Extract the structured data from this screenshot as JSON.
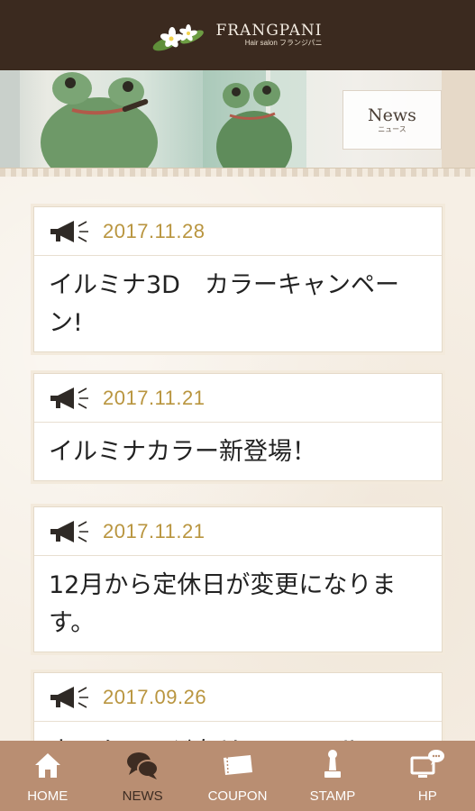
{
  "header": {
    "brand_name": "FRANGPANI",
    "brand_sub": "Hair salon フランジパニ",
    "logo_icon": "plumeria-flower-icon"
  },
  "banner": {
    "label_en": "News",
    "label_ja": "ニュース"
  },
  "news": [
    {
      "date": "2017.11.28",
      "title": "イルミナ3D　カラーキャンペーン!"
    },
    {
      "date": "2017.11.21",
      "title": "イルミナカラー新登場！"
    },
    {
      "date": "2017.11.21",
      "title": "12月から定休日が変更になります。"
    },
    {
      "date": "2017.09.26",
      "title": "ホームページをリニューアル"
    }
  ],
  "tabs": [
    {
      "label": "HOME",
      "icon": "home-icon",
      "active": false
    },
    {
      "label": "NEWS",
      "icon": "chat-bubbles-icon",
      "active": true
    },
    {
      "label": "COUPON",
      "icon": "coupon-ticket-icon",
      "active": false
    },
    {
      "label": "STAMP",
      "icon": "stamp-icon",
      "active": false
    },
    {
      "label": "HP",
      "icon": "monitor-chat-icon",
      "active": false
    }
  ],
  "colors": {
    "header_bg": "#3b2a1f",
    "date_gold": "#b9953f",
    "tabbar_bg": "#b98e72",
    "tab_active": "#3d2c22"
  }
}
